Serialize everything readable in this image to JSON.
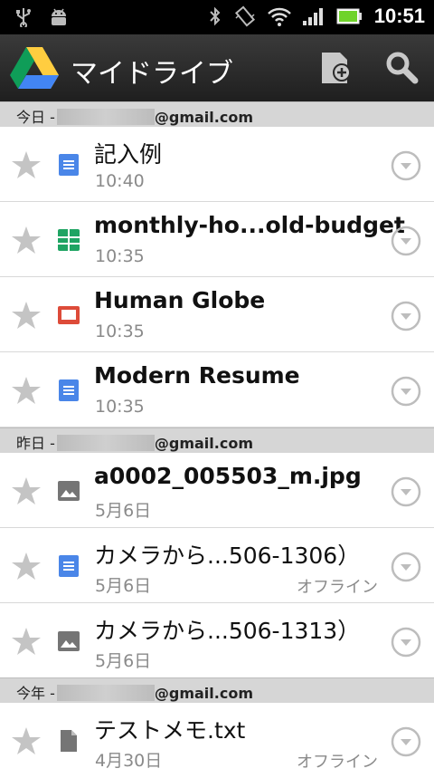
{
  "status_bar": {
    "time": "10:51",
    "icons": [
      "usb-icon",
      "android-debug-icon",
      "bluetooth-icon",
      "vibrate-icon",
      "wifi-icon",
      "signal-icon",
      "battery-icon"
    ]
  },
  "action_bar": {
    "title": "マイドライブ",
    "buttons": [
      "new-document-icon",
      "search-icon"
    ]
  },
  "sections": [
    {
      "prefix": "今日 -",
      "email_suffix": "@gmail.com",
      "items": [
        {
          "name": "記入例",
          "time": "10:40",
          "type": "document",
          "bold": false,
          "offline": ""
        },
        {
          "name": "monthly-ho...old-budget",
          "time": "10:35",
          "type": "spreadsheet",
          "bold": true,
          "offline": ""
        },
        {
          "name": "Human Globe",
          "time": "10:35",
          "type": "presentation",
          "bold": true,
          "offline": ""
        },
        {
          "name": "Modern Resume",
          "time": "10:35",
          "type": "document",
          "bold": true,
          "offline": ""
        }
      ]
    },
    {
      "prefix": "昨日 -",
      "email_suffix": "@gmail.com",
      "items": [
        {
          "name": "a0002_005503_m.jpg",
          "time": "5月6日",
          "type": "image",
          "bold": true,
          "offline": ""
        },
        {
          "name": "カメラから...506-1306）",
          "time": "5月6日",
          "type": "document",
          "bold": false,
          "offline": "オフライン"
        },
        {
          "name": "カメラから...506-1313）",
          "time": "5月6日",
          "type": "image",
          "bold": false,
          "offline": ""
        }
      ]
    },
    {
      "prefix": "今年 -",
      "email_suffix": "@gmail.com",
      "items": [
        {
          "name": "テストメモ.txt",
          "time": "4月30日",
          "type": "file",
          "bold": false,
          "offline": "オフライン"
        }
      ]
    }
  ],
  "colors": {
    "document": "#4a86e8",
    "spreadsheet": "#1fa463",
    "presentation": "#dd4b39",
    "image": "#757575",
    "file": "#757575"
  }
}
